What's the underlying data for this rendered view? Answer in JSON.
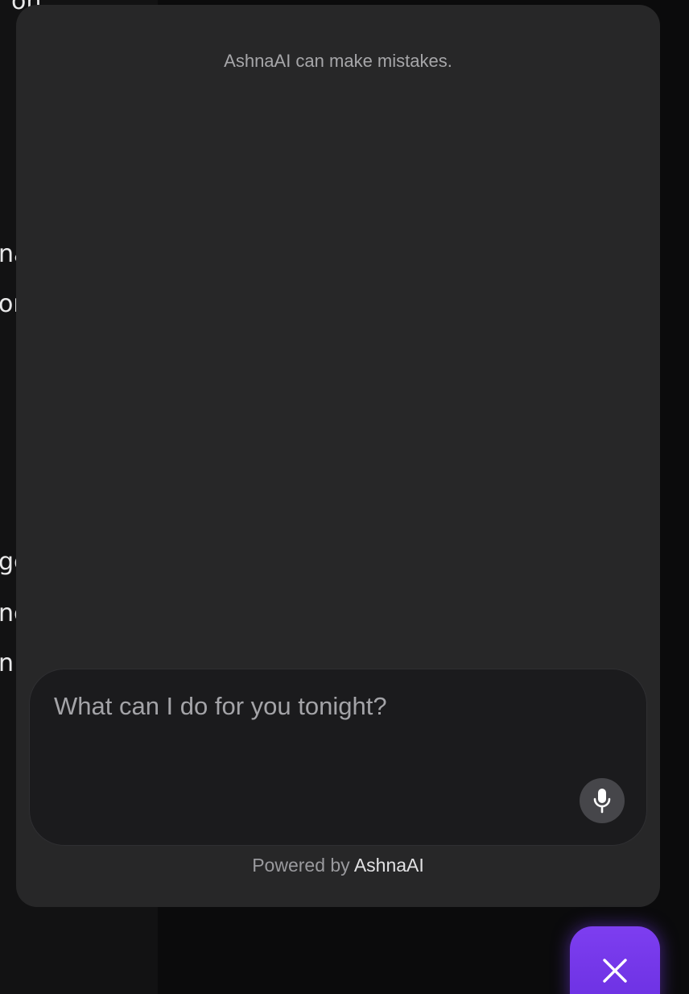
{
  "background": {
    "fragments": [
      "on",
      "na",
      "or",
      "ge",
      "nc",
      "n"
    ]
  },
  "chat": {
    "disclaimer": "AshnaAI can make mistakes.",
    "input": {
      "placeholder": "What can I do for you tonight?",
      "value": ""
    },
    "mic_icon": "microphone-icon",
    "powered_prefix": "Powered by",
    "powered_brand": "AshnaAI"
  },
  "fab": {
    "icon": "close-icon",
    "color": "#7b3cf0"
  },
  "colors": {
    "panel": "#272728",
    "composer": "#1b1b1d",
    "accent": "#7b3cf0"
  }
}
